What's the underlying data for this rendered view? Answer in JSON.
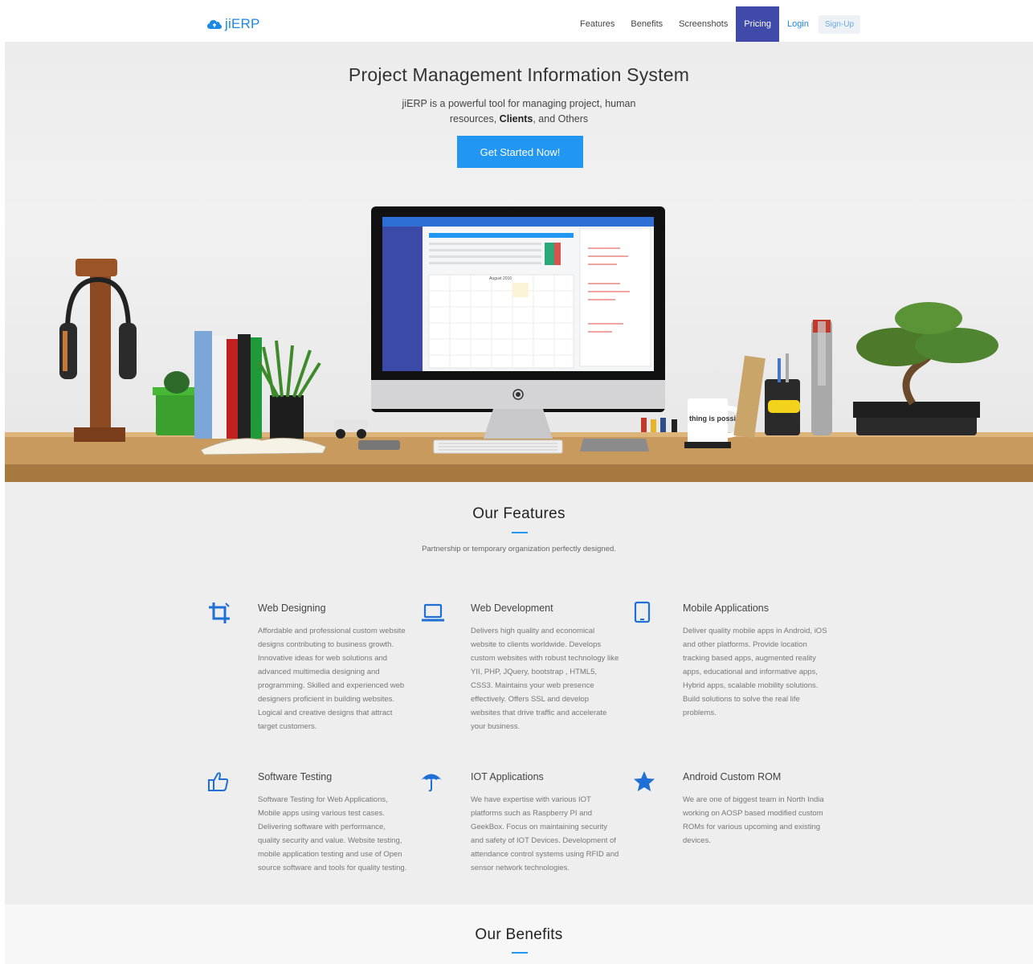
{
  "nav": {
    "brand": "jiERP",
    "links": [
      "Features",
      "Benefits",
      "Screenshots",
      "Pricing",
      "Login"
    ],
    "active": "Pricing",
    "signup": "Sign-Up"
  },
  "hero": {
    "title": "Project Management Information System",
    "subtitle_prefix": "jiERP is a powerful tool for managing project, human resources, ",
    "subtitle_bold": "Clients",
    "subtitle_suffix": ", and Others",
    "cta": "Get Started Now!",
    "calendar_month": "August 2016",
    "mug_text": "thing is possible."
  },
  "features": {
    "title": "Our Features",
    "subtitle": "Partnership or temporary organization perfectly designed.",
    "items": [
      {
        "icon": "crop-icon",
        "title": "Web Designing",
        "text": "Affordable and professional custom website designs contributing to business growth. Innovative ideas for web solutions and advanced multimedia designing and programming. Skilled and experienced web designers proficient in building websites. Logical and creative designs that attract target customers."
      },
      {
        "icon": "laptop-icon",
        "title": "Web Development",
        "text": "Delivers high quality and economical website to clients worldwide. Develops custom websites with robust technology like YII, PHP, JQuery, bootstrap , HTML5, CSS3. Maintains your web presence effectively. Offers SSL and develop websites that drive traffic and accelerate your business."
      },
      {
        "icon": "tablet-icon",
        "title": "Mobile Applications",
        "text": "Deliver quality mobile apps in Android, iOS and other platforms. Provide location tracking based apps, augmented reality apps, educational and informative apps, Hybrid apps, scalable mobility solutions. Build solutions to solve the real life problems."
      },
      {
        "icon": "thumbs-up-icon",
        "title": "Software Testing",
        "text": "Software Testing for Web Applications, Mobile apps using various test cases. Delivering software with performance, quality security and value. Website testing, mobile application testing and use of Open source software and tools for quality testing."
      },
      {
        "icon": "umbrella-icon",
        "title": "IOT Applications",
        "text": "We have expertise with various IOT platforms such as Raspberry PI and GeekBox. Focus on maintaining security and safety of IOT Devices. Development of attendance control systems using RFID and sensor network technologies."
      },
      {
        "icon": "star-icon",
        "title": "Android Custom ROM",
        "text": "We are one of biggest team in North India working on AOSP based modified custom ROMs for various upcoming and existing devices."
      }
    ]
  },
  "benefits": {
    "title": "Our Benefits"
  },
  "colors": {
    "accent": "#2196f3",
    "nav_active": "#3f4aa9",
    "brand": "#1e88e5"
  }
}
